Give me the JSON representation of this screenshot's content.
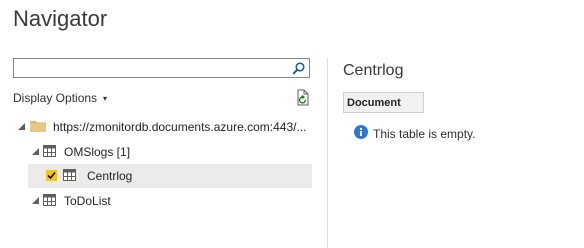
{
  "title": "Navigator",
  "search": {
    "value": "",
    "placeholder": ""
  },
  "display_options": {
    "label": "Display Options",
    "caret": "▾"
  },
  "tree": {
    "source": {
      "label": "https://zmonitordb.documents.azure.com:443/..."
    },
    "database": {
      "label": "OMSlogs [1]"
    },
    "selected_item": {
      "label": "Centrlog",
      "checked": true
    },
    "other_item": {
      "label": "ToDoList"
    }
  },
  "preview": {
    "title": "Centrlog",
    "column_header": "Document",
    "empty_message": "This table is empty."
  },
  "colors": {
    "checkbox": "#f2c811",
    "folder": "#dcb67a",
    "info": "#2b79d3",
    "selection": "#edebe9"
  },
  "icons": [
    "search-icon",
    "refresh-icon",
    "folder-icon",
    "table-icon",
    "check-icon",
    "info-icon",
    "expand-arrow-icon"
  ]
}
